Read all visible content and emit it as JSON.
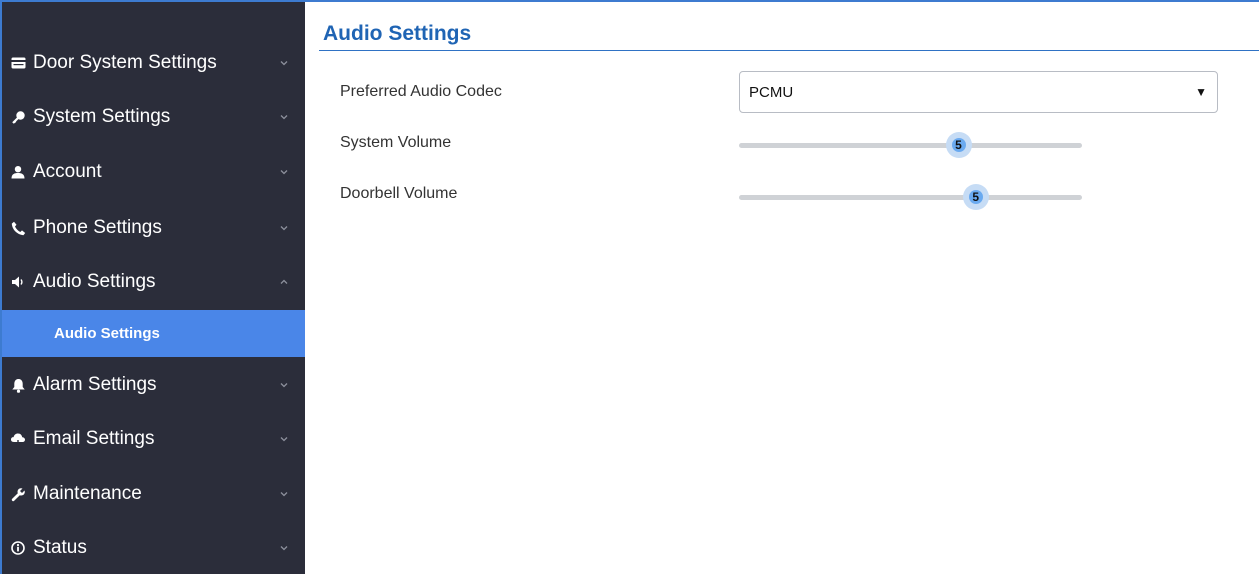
{
  "sidebar": {
    "items": [
      {
        "label": "Door System Settings",
        "icon": "card-icon",
        "expanded": false
      },
      {
        "label": "System Settings",
        "icon": "key-icon",
        "expanded": false
      },
      {
        "label": "Account",
        "icon": "user-icon",
        "expanded": false
      },
      {
        "label": "Phone Settings",
        "icon": "phone-icon",
        "expanded": false
      },
      {
        "label": "Audio Settings",
        "icon": "volume-icon",
        "expanded": true
      },
      {
        "label": "Alarm Settings",
        "icon": "bell-icon",
        "expanded": false
      },
      {
        "label": "Email Settings",
        "icon": "cloud-icon",
        "expanded": false
      },
      {
        "label": "Maintenance",
        "icon": "wrench-icon",
        "expanded": false
      },
      {
        "label": "Status",
        "icon": "info-icon",
        "expanded": false
      }
    ],
    "active_sub_item": "Audio Settings"
  },
  "main": {
    "title": "Audio Settings",
    "fields": {
      "codec": {
        "label": "Preferred Audio Codec",
        "value": "PCMU"
      },
      "system_volume": {
        "label": "System Volume",
        "value": "5",
        "fraction": 0.64
      },
      "doorbell_volume": {
        "label": "Doorbell Volume",
        "value": "5",
        "fraction": 0.69
      }
    }
  },
  "colors": {
    "sidebar_bg": "#2b2d3a",
    "active_bg": "#4a86e8",
    "title": "#1f64b4",
    "slider_thumb": "#6aaaf0"
  }
}
